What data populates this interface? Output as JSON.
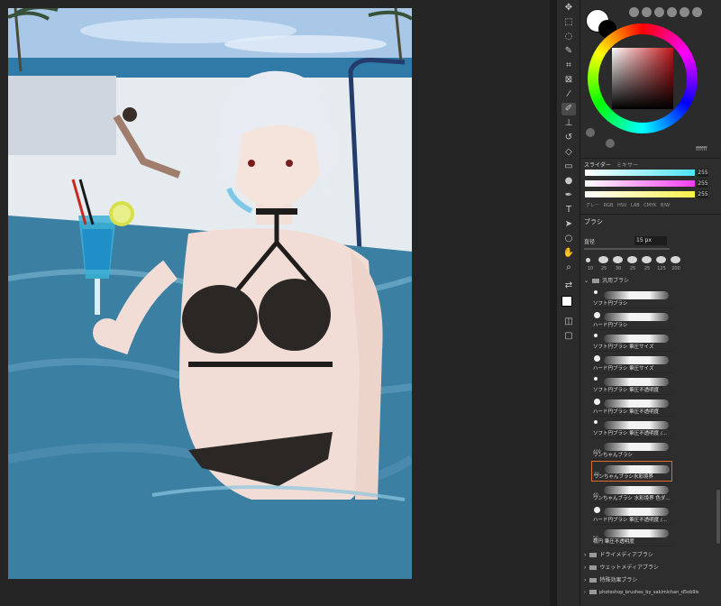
{
  "colors": {
    "foreground": "#ffffff",
    "background_swatch": "#000000",
    "selected_hue": "#c01418",
    "hex_value": "ffffff",
    "selected_brush_outline": "#e06a2a"
  },
  "color_panel": {
    "tabs": [
      "スライダー",
      "ミキサー"
    ],
    "sliders": [
      {
        "color": "cyan",
        "value": "255"
      },
      {
        "color": "magenta",
        "value": "255"
      },
      {
        "color": "yellow",
        "value": "255"
      }
    ],
    "modes": [
      "グレー",
      "RGB",
      "HSV",
      "LAB",
      "CMYK",
      "B/W"
    ]
  },
  "brush_panel": {
    "tab_label": "ブラシ",
    "size_label": "直径",
    "size_value": "15 px",
    "presets": [
      "10",
      "25",
      "30",
      "25",
      "25",
      "125",
      "200"
    ],
    "groups": [
      {
        "label": "汎用ブラシ",
        "expanded": true
      },
      {
        "label": "ドライメディアブラシ",
        "expanded": false
      },
      {
        "label": "ウェットメディアブラシ",
        "expanded": false
      },
      {
        "label": "特殊効果ブラシ",
        "expanded": false
      },
      {
        "label": "photoshop_brushes_by_sakimichan_d5ob9is",
        "expanded": false
      }
    ],
    "brushes": [
      {
        "name": "ソフト円ブラシ",
        "num": ""
      },
      {
        "name": "ハード円ブラシ",
        "num": ""
      },
      {
        "name": "ソフト円ブラシ 筆圧サイズ",
        "num": ""
      },
      {
        "name": "ハード円ブラシ 筆圧サイズ",
        "num": ""
      },
      {
        "name": "ソフト円ブラシ 筆圧不透明度",
        "num": ""
      },
      {
        "name": "ハード円ブラシ 筆圧不透明度",
        "num": ""
      },
      {
        "name": "ソフト円ブラシ 筆圧不透明度 /...",
        "num": ""
      },
      {
        "name": "ワンちゃんブラシ",
        "num": "400"
      },
      {
        "name": "ワンちゃんブラシ水彩境界",
        "num": "40",
        "selected": true
      },
      {
        "name": "ワンちゃんブラシ 水彩境界 色ダ...",
        "num": "40"
      },
      {
        "name": "ハード円ブラシ 筆圧不透明度 /...",
        "num": ""
      },
      {
        "name": "楕円 筆圧不透明度",
        "num": "50"
      }
    ]
  },
  "toolbar": {
    "tools": [
      "move-tool",
      "marquee-tool",
      "lasso-tool",
      "quick-select-tool",
      "crop-tool",
      "frame-tool",
      "eyedropper-tool",
      "healing-tool",
      "brush-tool",
      "stamp-tool",
      "history-brush-tool",
      "eraser-tool",
      "gradient-tool",
      "blur-tool",
      "dodge-tool",
      "pen-tool",
      "type-tool",
      "path-select-tool",
      "shape-tool",
      "hand-tool",
      "zoom-tool"
    ]
  }
}
